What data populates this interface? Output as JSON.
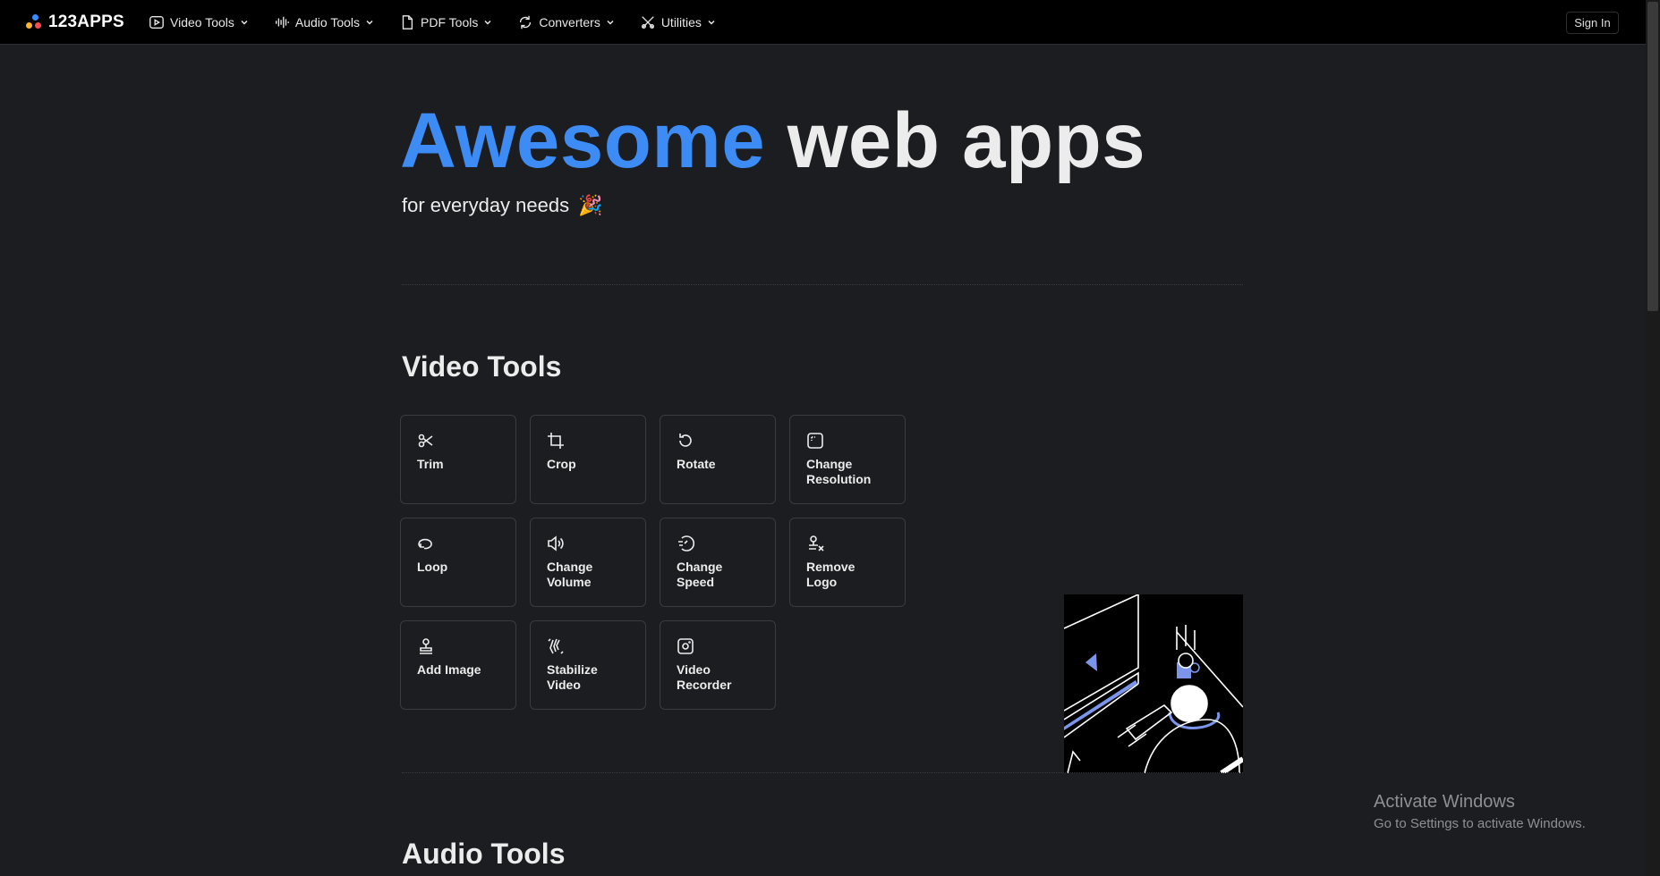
{
  "header": {
    "logo_text": "123APPS",
    "nav": [
      {
        "label": "Video Tools",
        "icon": "play-circle-icon"
      },
      {
        "label": "Audio Tools",
        "icon": "waveform-icon"
      },
      {
        "label": "PDF Tools",
        "icon": "document-icon"
      },
      {
        "label": "Converters",
        "icon": "convert-icon"
      },
      {
        "label": "Utilities",
        "icon": "tools-icon"
      }
    ],
    "signin_label": "Sign In"
  },
  "hero": {
    "title_highlight": "Awesome",
    "title_rest": "web apps",
    "subtitle": "for everyday needs",
    "emoji": "🎉"
  },
  "sections": {
    "video_tools_title": "Video Tools",
    "audio_tools_title": "Audio Tools"
  },
  "video_tools": [
    {
      "label": "Trim",
      "icon": "scissors-icon"
    },
    {
      "label": "Crop",
      "icon": "crop-icon"
    },
    {
      "label": "Rotate",
      "icon": "rotate-icon"
    },
    {
      "label": "Change Resolution",
      "icon": "resolution-icon"
    },
    {
      "label": "Loop",
      "icon": "loop-icon"
    },
    {
      "label": "Change Volume",
      "icon": "volume-icon"
    },
    {
      "label": "Change Speed",
      "icon": "speed-icon"
    },
    {
      "label": "Remove Logo",
      "icon": "remove-logo-icon"
    },
    {
      "label": "Add Image",
      "icon": "stamp-icon"
    },
    {
      "label": "Stabilize Video",
      "icon": "stabilize-icon"
    },
    {
      "label": "Video Recorder",
      "icon": "recorder-icon"
    }
  ],
  "watermark": {
    "line1": "Activate Windows",
    "line2": "Go to Settings to activate Windows."
  },
  "colors": {
    "accent": "#3d8cf5",
    "background": "#1c1d20",
    "topbar": "#000000"
  }
}
